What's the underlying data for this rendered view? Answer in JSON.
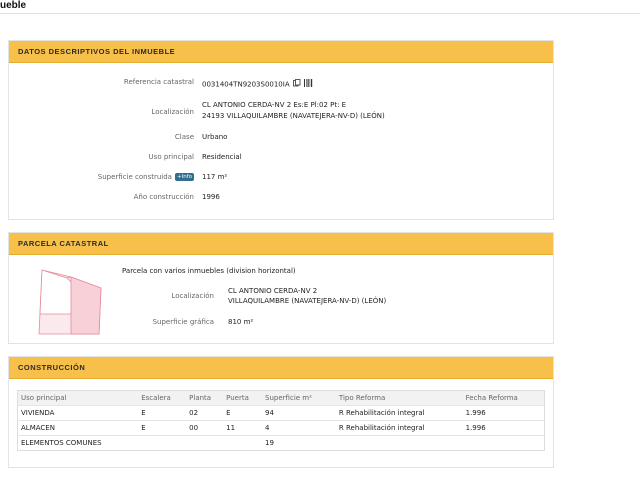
{
  "page": {
    "title_fragment": "ueble"
  },
  "datos": {
    "header": "DATOS DESCRIPTIVOS DEL INMUEBLE",
    "referencia_label": "Referencia catastral",
    "referencia_value": "0031404TN9203S0010IA",
    "localizacion_label": "Localización",
    "localizacion_line1": "CL ANTONIO CERDA-NV 2 Es:E Pl:02 Pt: E",
    "localizacion_line2": "24193 VILLAQUILAMBRE (NAVATEJERA-NV-D) (LEÓN)",
    "clase_label": "Clase",
    "clase_value": "Urbano",
    "uso_label": "Uso principal",
    "uso_value": "Residencial",
    "superficie_label": "Superficie construida",
    "info_badge": "+Info",
    "superficie_value": "117 m²",
    "anio_label": "Año construcción",
    "anio_value": "1996"
  },
  "parcela": {
    "header": "PARCELA CATASTRAL",
    "description": "Parcela con varios inmuebles (division horizontal)",
    "localizacion_label": "Localización",
    "localizacion_line1": "CL ANTONIO CERDA-NV 2",
    "localizacion_line2": "VILLAQUILAMBRE (NAVATEJERA-NV-D) (LEÓN)",
    "superficie_label": "Superficie gráfica",
    "superficie_value": "810 m²"
  },
  "construccion": {
    "header": "CONSTRUCCIÓN",
    "columns": [
      "Uso principal",
      "Escalera",
      "Planta",
      "Puerta",
      "Superficie m²",
      "Tipo Reforma",
      "Fecha Reforma"
    ],
    "rows": [
      [
        "VIVIENDA",
        "E",
        "02",
        "E",
        "94",
        "R Rehabilitación integral",
        "1.996"
      ],
      [
        "ALMACEN",
        "E",
        "00",
        "11",
        "4",
        "R Rehabilitación integral",
        "1.996"
      ],
      [
        "ELEMENTOS COMUNES",
        "",
        "",
        "",
        "19",
        "",
        ""
      ]
    ]
  },
  "colors": {
    "header_bg": "#f7c04a",
    "plot_fill": "#f8d9de",
    "plot_stroke": "#e88a99",
    "badge_bg": "#2f6e8f"
  }
}
